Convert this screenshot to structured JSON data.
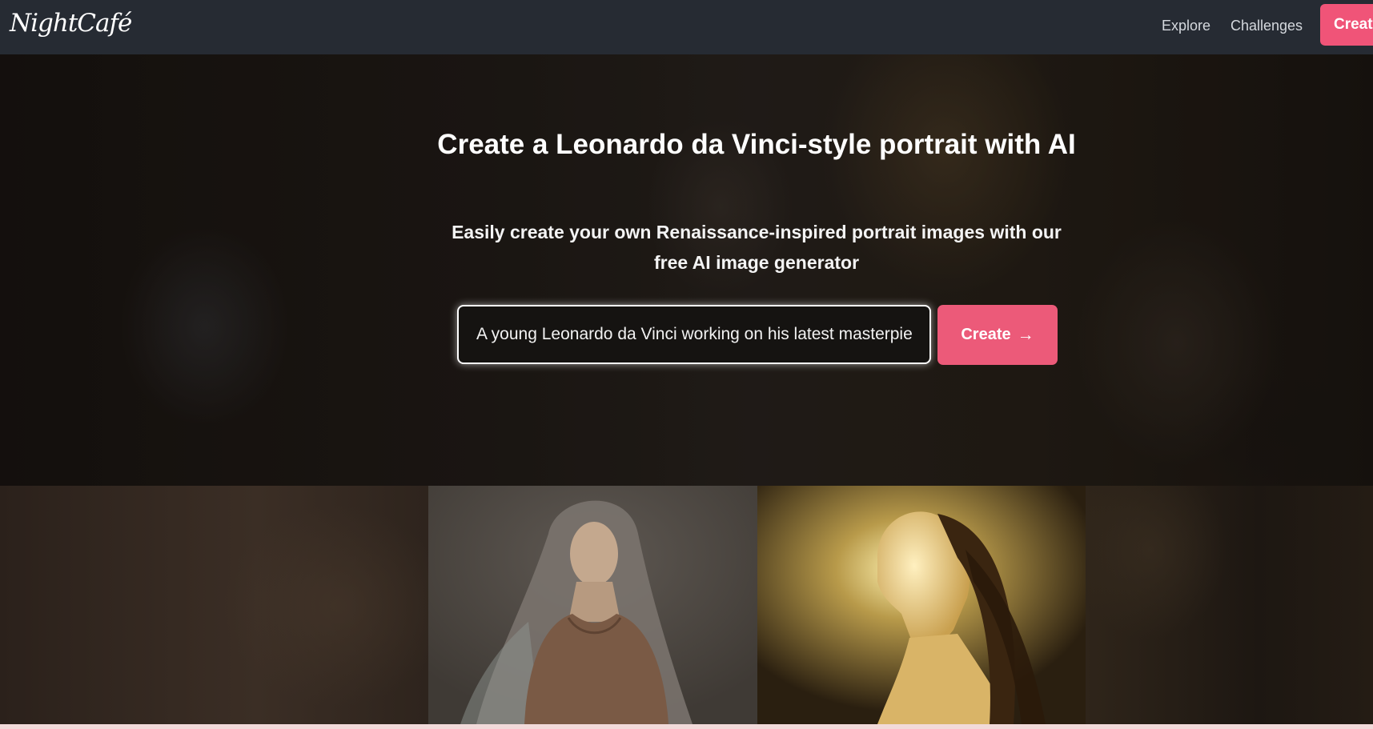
{
  "nav": {
    "logo": "NightCafé",
    "links": [
      "Explore",
      "Challenges"
    ],
    "create_label": "Create"
  },
  "hero": {
    "title": "Create a Leonardo da Vinci-style portrait with AI",
    "subtitle": "Easily create your own Renaissance-inspired portrait images with our free AI image generator",
    "prompt_value": "A young Leonardo da Vinci working on his latest masterpiece",
    "create_label": "Create",
    "button_icon": "arrow-right-icon"
  },
  "colors": {
    "nav_bg": "#262b33",
    "accent": "#f05478"
  }
}
